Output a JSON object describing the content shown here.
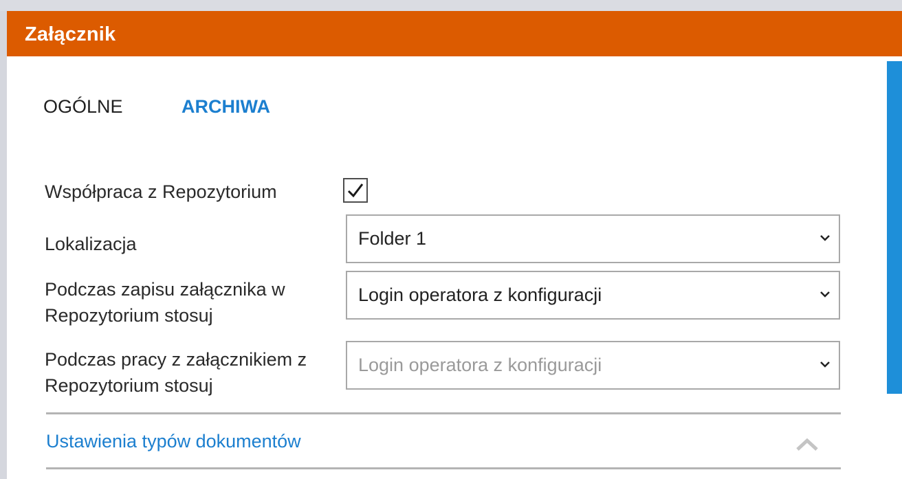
{
  "window": {
    "title": "Załącznik"
  },
  "tabs": [
    {
      "label": "OGÓLNE",
      "active": false
    },
    {
      "label": "ARCHIWA",
      "active": true
    }
  ],
  "form": {
    "repository_label": "Współpraca z Repozytorium",
    "repository_checked": true,
    "location_label": "Lokalizacja",
    "location_value": "Folder 1",
    "save_label_line1": "Podczas zapisu załącznika w",
    "save_label_line2": "Repozytorium stosuj",
    "save_value": "Login operatora z konfiguracji",
    "work_label_line1": "Podczas pracy z załącznikiem z",
    "work_label_line2": "Repozytorium stosuj",
    "work_value": "Login operatora z konfiguracji",
    "work_value_disabled": true
  },
  "section": {
    "title": "Ustawienia typów dokumentów",
    "expanded": true
  },
  "colors": {
    "accent": "#dc5b00",
    "link": "#1c7fcf",
    "scrollbar": "#1e8fd9"
  },
  "icons": {
    "dropdown": "chevron-down-icon",
    "collapse": "chevron-up-icon",
    "check": "checkmark-icon"
  }
}
